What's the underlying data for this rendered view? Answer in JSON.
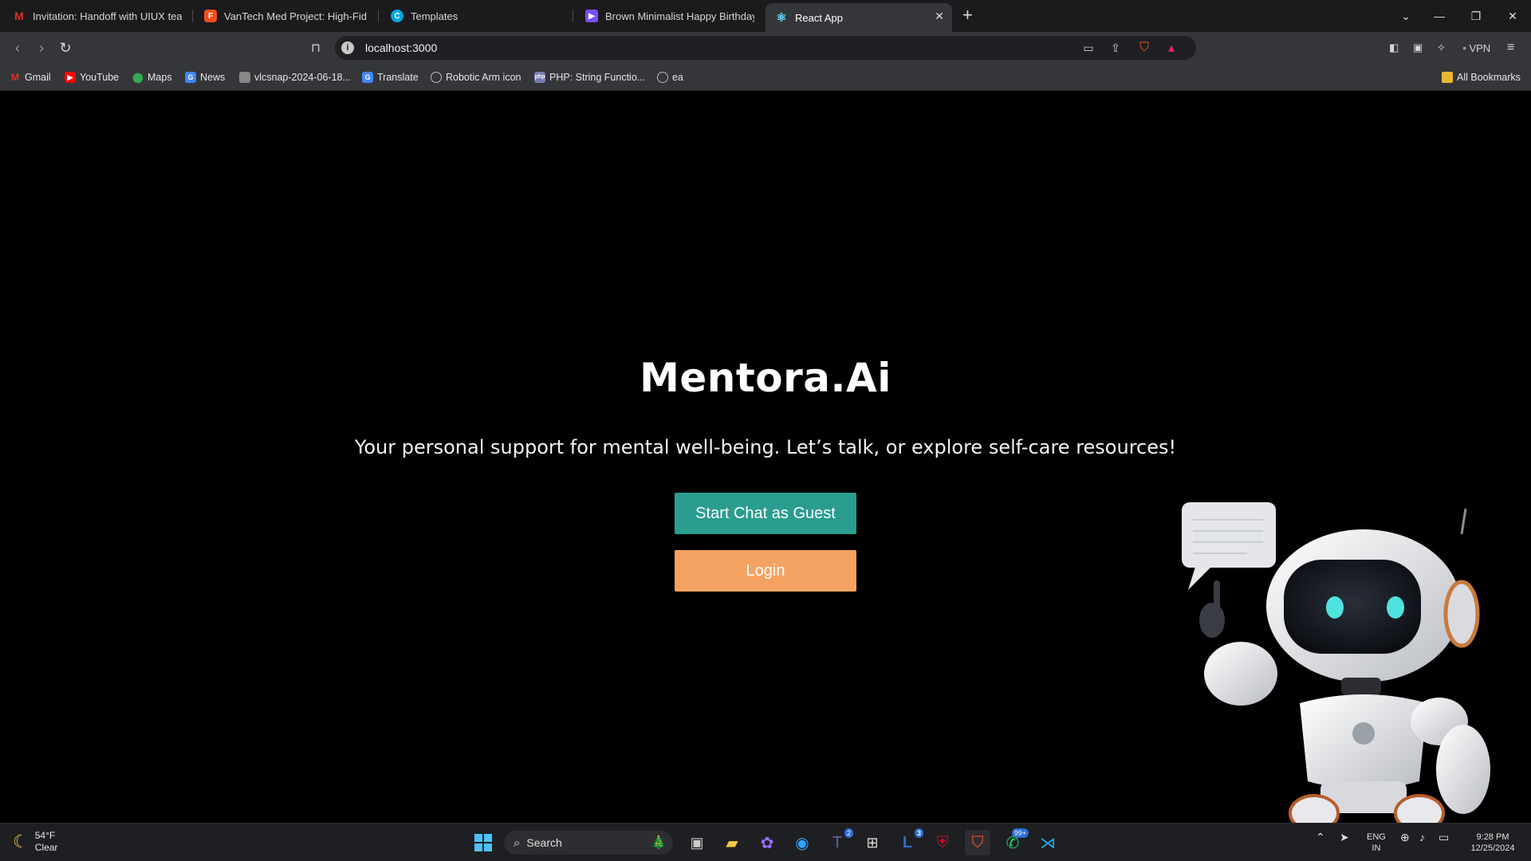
{
  "browser": {
    "tabs": [
      {
        "label": "Invitation: Handoff with UIUX team",
        "favicon": "gmail-icon",
        "color": "#d93025"
      },
      {
        "label": "VanTech Med Project: High-Fidelity",
        "favicon": "figma-icon",
        "color": "#f24e1e"
      },
      {
        "label": "Templates",
        "favicon": "canva-icon",
        "color": "#00a7e1"
      },
      {
        "label": "Brown Minimalist Happy Birthday M",
        "favicon": "video-icon",
        "color": "#7b4dff"
      },
      {
        "label": "React App",
        "favicon": "react-icon",
        "color": "#61dafb"
      }
    ],
    "url": "localhost:3000",
    "vpn_label": "VPN",
    "bookmarks": [
      {
        "label": "Gmail",
        "color": "#d93025"
      },
      {
        "label": "YouTube",
        "color": "#ff0000"
      },
      {
        "label": "Maps",
        "color": "#34a853"
      },
      {
        "label": "News",
        "color": "#4285f4"
      },
      {
        "label": "vlcsnap-2024-06-18...",
        "color": "#888888"
      },
      {
        "label": "Translate",
        "color": "#4285f4"
      },
      {
        "label": "Robotic Arm icon",
        "color": "#bbbbbb"
      },
      {
        "label": "PHP: String Functio...",
        "color": "#777bb3"
      },
      {
        "label": "ea",
        "color": "#bbbbbb"
      }
    ],
    "all_bookmarks_label": "All Bookmarks"
  },
  "page": {
    "title": "Mentora.Ai",
    "subtitle": "Your personal support for mental well-being. Let’s talk, or explore self-care resources!",
    "guest_button": "Start Chat as Guest",
    "login_button": "Login",
    "guest_color": "#2a9d8f",
    "login_color": "#f4a261"
  },
  "taskbar": {
    "weather_temp": "54°F",
    "weather_desc": "Clear",
    "search_placeholder": "Search",
    "badges": {
      "teams": "2",
      "lens": "3",
      "whatsapp": "99+"
    },
    "language": "ENG",
    "region": "IN",
    "time": "9:28 PM",
    "date": "12/25/2024"
  }
}
